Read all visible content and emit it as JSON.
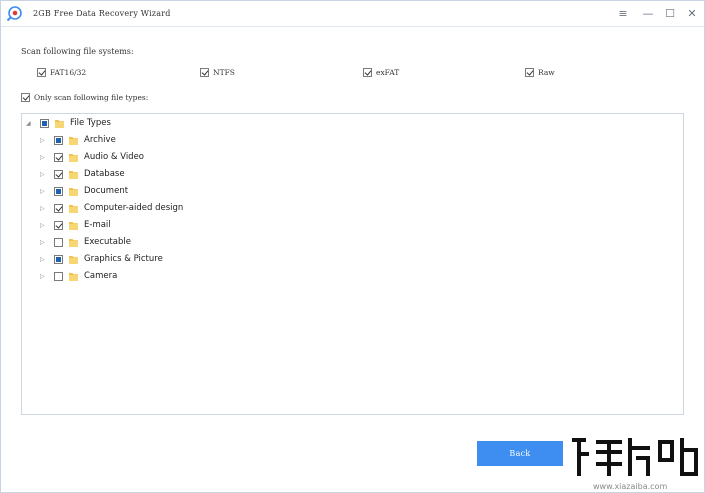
{
  "window": {
    "title": "2GB Free Data Recovery Wizard",
    "buttons": {
      "menu": "≡",
      "minimize": "—",
      "maximize": "☐",
      "close": "✕"
    }
  },
  "filesystems": {
    "label": "Scan following file systems:",
    "items": [
      {
        "label": "FAT16/32",
        "checked": true
      },
      {
        "label": "NTFS",
        "checked": true
      },
      {
        "label": "exFAT",
        "checked": true
      },
      {
        "label": "Raw",
        "checked": true
      }
    ]
  },
  "only_types": {
    "label": "Only scan following file types:",
    "checked": true
  },
  "tree": {
    "root": {
      "label": "File Types",
      "state": "partial"
    },
    "items": [
      {
        "label": "Archive",
        "state": "partial"
      },
      {
        "label": "Audio & Video",
        "state": "checked"
      },
      {
        "label": "Database",
        "state": "checked"
      },
      {
        "label": "Document",
        "state": "partial"
      },
      {
        "label": "Computer-aided design",
        "state": "checked"
      },
      {
        "label": "E-mail",
        "state": "checked"
      },
      {
        "label": "Executable",
        "state": "unchecked"
      },
      {
        "label": "Graphics & Picture",
        "state": "partial"
      },
      {
        "label": "Camera",
        "state": "unchecked"
      }
    ]
  },
  "back_button": "Back",
  "watermark": {
    "text": "www.xiazaiba.com"
  },
  "colors": {
    "accent": "#3d8ef0",
    "folder": "#f2c14b",
    "partial_fill": "#1f5fb4"
  }
}
